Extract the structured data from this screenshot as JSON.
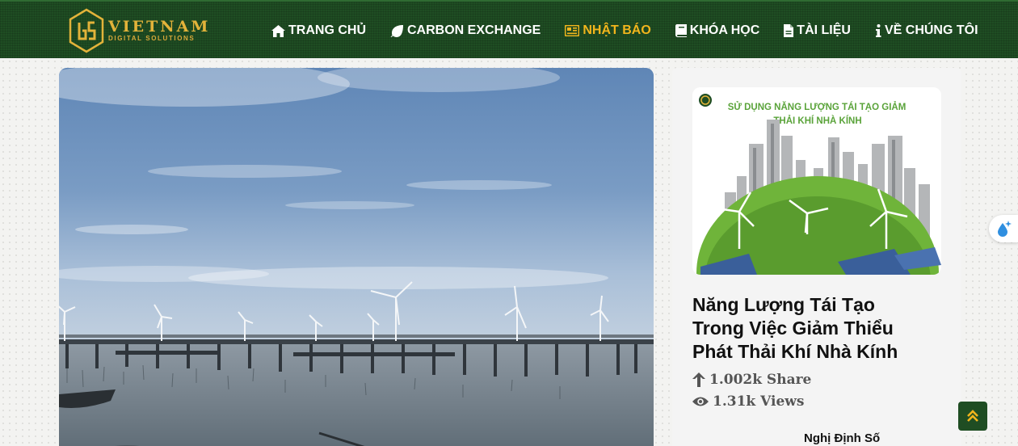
{
  "brand": {
    "name": "VIETNAM",
    "tagline": "DIGITAL SOLUTIONS",
    "logo_icon": "vds-logo-icon"
  },
  "colors": {
    "header_bg": "#1f4d23",
    "nav_text": "#ffffff",
    "nav_active": "#f2b51c",
    "logo_gold": "#e3b33a"
  },
  "nav": [
    {
      "label": "TRANG CHỦ",
      "icon": "home-icon",
      "active": false
    },
    {
      "label": "CARBON EXCHANGE",
      "icon": "leaf-icon",
      "active": false
    },
    {
      "label": "NHẬT BÁO",
      "icon": "newspaper-icon",
      "active": true
    },
    {
      "label": "KHÓA HỌC",
      "icon": "book-icon",
      "active": false
    },
    {
      "label": "TÀI LIỆU",
      "icon": "file-icon",
      "active": false
    },
    {
      "label": "VỀ CHÚNG TÔI",
      "icon": "info-icon",
      "active": false
    }
  ],
  "hero": {
    "image": "wind-farm-over-water-photo"
  },
  "sidebar": {
    "card": {
      "thumb_caption_line1": "SỬ DỤNG NĂNG LƯỢNG TÁI TẠO GIẢM",
      "thumb_caption_line2": "THẢI KHÍ NHÀ KÍNH",
      "title": "Năng Lượng Tái Tạo Trong Việc Giảm Thiểu Phát Thải Khí Nhà Kính",
      "shares": "1.002k Share",
      "views": "1.31k Views"
    },
    "next_title": "Nghị Định Số"
  },
  "widgets": {
    "floating": "water-drop-sparkle-icon",
    "scroll_top": "chevron-double-up-icon"
  }
}
